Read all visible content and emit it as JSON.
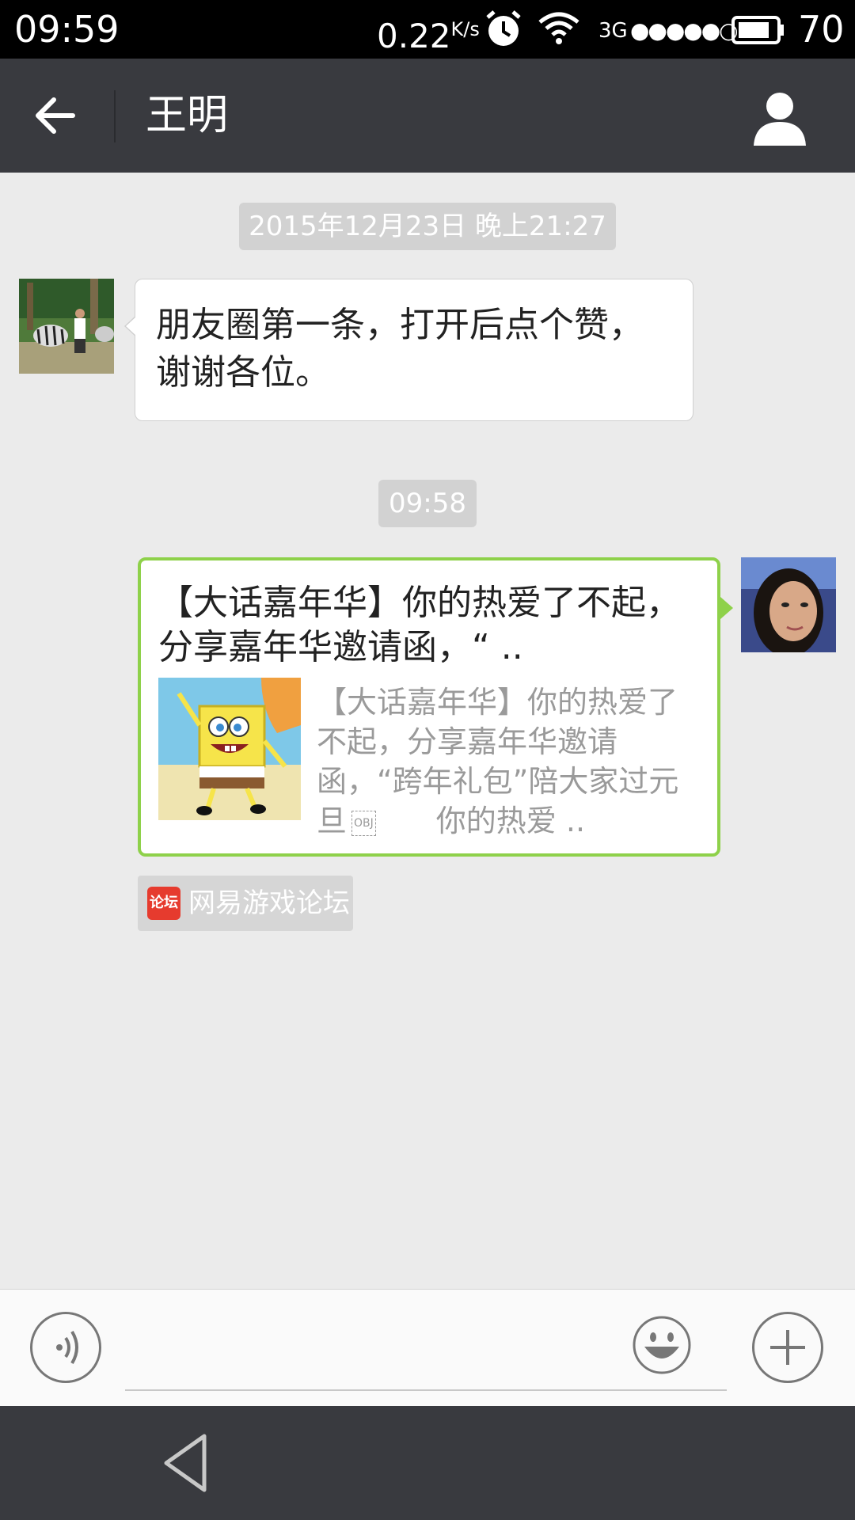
{
  "status_bar": {
    "time": "09:59",
    "speed_value": "0.22",
    "speed_unit": "K/s",
    "network": "3G",
    "signal_dots": "●●●●●○",
    "battery": "70"
  },
  "header": {
    "title": "王明",
    "back_icon": "back-arrow-icon",
    "profile_icon": "person-icon"
  },
  "chat": {
    "timestamp_1": "2015年12月23日 晚上21:27",
    "incoming_message": "朋友圈第一条，打开后点个赞，谢谢各位。",
    "timestamp_2": "09:58",
    "link_card": {
      "title": "【大话嘉年华】你的热爱了不起，分享嘉年华邀请函，“ ..",
      "desc_part1": "【大话嘉年华】你的热爱了不起，分享嘉年华邀请函，“跨年礼包”陪大家过元旦",
      "obj_label": "OBJ",
      "desc_part2": "你的热爱 .."
    },
    "source": {
      "icon_text": "论坛",
      "label": "网易游戏论坛"
    }
  },
  "input_bar": {
    "placeholder": "",
    "voice_icon": "voice-icon",
    "emoji_icon": "emoji-icon",
    "add_icon": "plus-icon"
  },
  "colors": {
    "header_bg": "#393a3f",
    "chat_bg": "#ebebeb",
    "card_border": "#8ed14a",
    "source_icon_red": "#e63b2e"
  }
}
